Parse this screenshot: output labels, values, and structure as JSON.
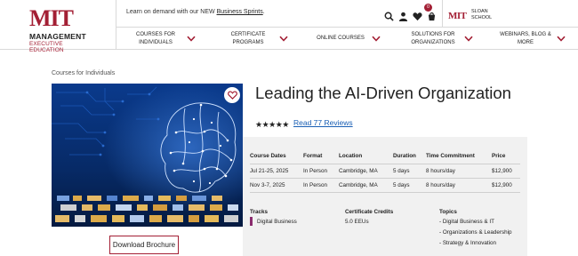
{
  "brand": {
    "logo_mark": "MIT",
    "logo_line1": "MANAGEMENT",
    "logo_line2": "EXECUTIVE EDUCATION",
    "sloan_mark": "MIT",
    "sloan_line1": "SLOAN",
    "sloan_line2": "SCHOOL",
    "accent_color": "#a31f34"
  },
  "promo": {
    "text": "Learn on demand with our NEW ",
    "link": "Business Sprints",
    "suffix": "."
  },
  "header_icons": [
    "search-icon",
    "user-icon",
    "heart-icon",
    "cart-icon"
  ],
  "cart_count": "0",
  "nav": [
    {
      "label": "COURSES FOR INDIVIDUALS"
    },
    {
      "label": "CERTIFICATE PROGRAMS"
    },
    {
      "label": "ONLINE COURSES"
    },
    {
      "label": "SOLUTIONS FOR ORGANIZATIONS"
    },
    {
      "label": "WEBINARS, BLOG & MORE"
    }
  ],
  "breadcrumb": "Courses for Individuals",
  "course": {
    "title": "Leading the AI-Driven Organization",
    "stars": "★★★★★",
    "rating": 5,
    "reviews_link": "Read 77 Reviews"
  },
  "schedule": {
    "headers": [
      "Course Dates",
      "Format",
      "Location",
      "Duration",
      "Time Commitment",
      "Price"
    ],
    "rows": [
      [
        "Jul 21-25, 2025",
        "In Person",
        "Cambridge, MA",
        "5 days",
        "8 hours/day",
        "$12,900"
      ],
      [
        "Nov 3-7, 2025",
        "In Person",
        "Cambridge, MA",
        "5 days",
        "8 hours/day",
        "$12,900"
      ]
    ]
  },
  "meta": {
    "tracks_label": "Tracks",
    "tracks_value": "Digital Business",
    "credits_label": "Certificate Credits",
    "credits_value": "5.0 EEUs",
    "topics_label": "Topics",
    "topics": [
      "- Digital Business & IT",
      "- Organizations & Leadership",
      "- Strategy & Innovation"
    ]
  },
  "brochure_button": "Download Brochure"
}
